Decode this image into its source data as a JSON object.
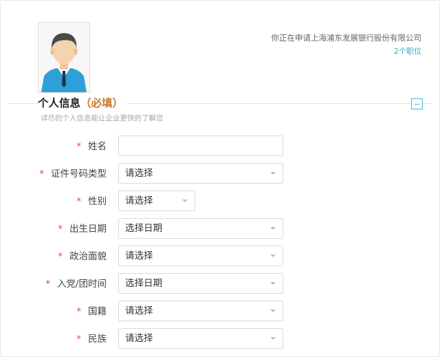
{
  "header": {
    "applying_text": "你正在申请上海浦东发展银行股份有限公司",
    "positions_link": "2个职位"
  },
  "section": {
    "title": "个人信息",
    "required_tag": "（必填）",
    "subtitle": "详尽的个人信息能让企业更快的了解您"
  },
  "colors": {
    "accent": "#3ba6c4",
    "required_star": "#d9453a",
    "required_tag": "#c8792a"
  },
  "form": {
    "fields": [
      {
        "label": "姓名",
        "type": "text",
        "value": ""
      },
      {
        "label": "证件号码类型",
        "type": "select",
        "value": "请选择"
      },
      {
        "label": "性别",
        "type": "select",
        "value": "请选择"
      },
      {
        "label": "出生日期",
        "type": "date",
        "value": "选择日期"
      },
      {
        "label": "政治面貌",
        "type": "select",
        "value": "请选择"
      },
      {
        "label": "入党/团时间",
        "type": "date",
        "value": "选择日期"
      },
      {
        "label": "国籍",
        "type": "select",
        "value": "请选择"
      },
      {
        "label": "民族",
        "type": "select",
        "value": "请选择"
      }
    ]
  },
  "icons": {
    "avatar": "user-avatar-icon",
    "collapse": "minus-icon",
    "dropdown": "caret-down-icon"
  }
}
